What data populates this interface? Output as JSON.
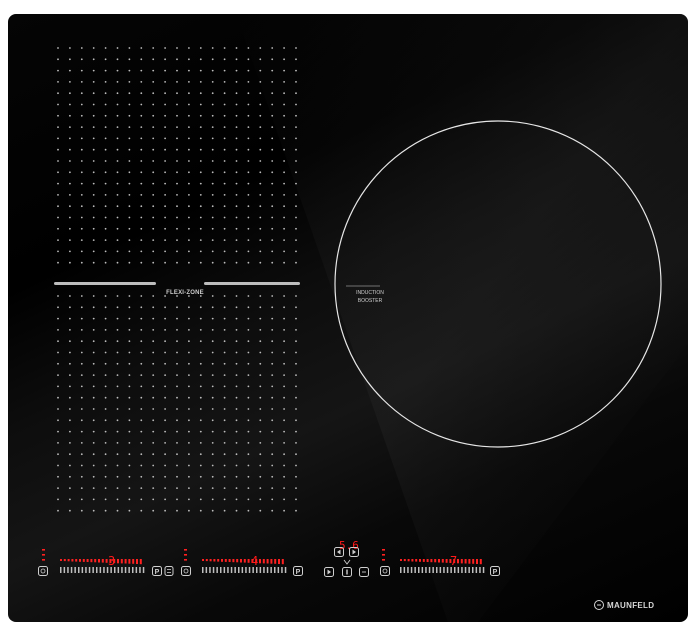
{
  "hob": {
    "flexi_zone_label": "FLEXI-ZONE",
    "induction_label": "INDUCTION",
    "booster_label": "BOOSTER",
    "brand": "MAUNFELD",
    "zones": [
      {
        "display": "3"
      },
      {
        "display": "4"
      },
      {
        "display": "7"
      }
    ],
    "timer_display": "5.6"
  },
  "colors": {
    "glass": "#000000",
    "print": "#d0d0d0",
    "display_red": "#ff1a1a"
  },
  "icons": [
    "power-icon",
    "pause-icon",
    "lock-icon",
    "play-icon",
    "minus-icon",
    "plus-icon",
    "timer-icon",
    "booster-p-icon"
  ]
}
